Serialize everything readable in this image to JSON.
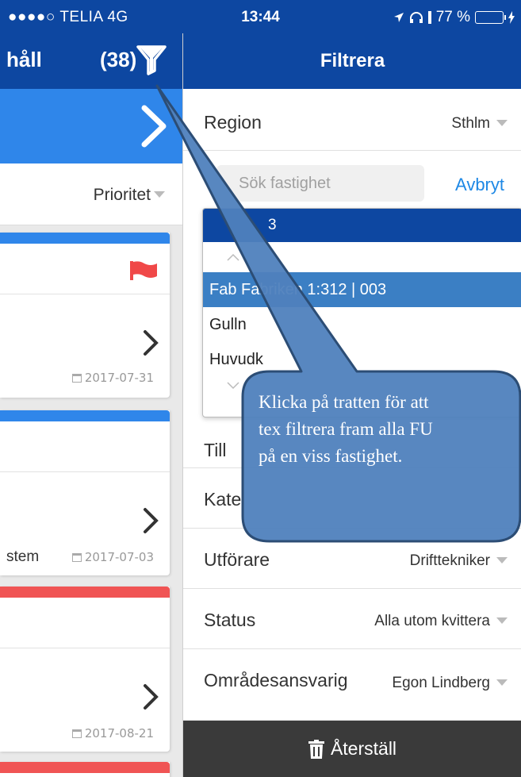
{
  "status_bar": {
    "carrier": "●●●●○ TELIA  4G",
    "time": "13:44",
    "battery": "77 %",
    "battery_level": 0.77
  },
  "left_pane": {
    "header_title": "håll",
    "count": "(38)",
    "sort_label": "Prioritet",
    "cards": [
      {
        "stripe_color": "#2f86ea",
        "flag": true,
        "note": "",
        "date": "2017-07-31"
      },
      {
        "stripe_color": "#2f86ea",
        "flag": false,
        "note": "stem",
        "date": "2017-07-03"
      },
      {
        "stripe_color": "#f05454",
        "flag": false,
        "note": "",
        "date": "2017-08-21"
      }
    ]
  },
  "filter_panel": {
    "title": "Filtrera",
    "region_label": "Region",
    "region_value": "Sthlm",
    "search_placeholder": "Sök fastighet",
    "cancel_label": "Avbryt",
    "dropdown": {
      "header": "3",
      "items": [
        {
          "label": "Fab     Fabriken 1:312 | 003",
          "selected": true
        },
        {
          "label": "Gulln",
          "selected": false
        },
        {
          "label": "Huvudk",
          "selected": false
        }
      ]
    },
    "rows": [
      {
        "label": "Till",
        "value": ""
      },
      {
        "label": "Kate",
        "value": ""
      },
      {
        "label": "Utförare",
        "value": "Drifttekniker"
      },
      {
        "label": "Status",
        "value": "Alla utom kvittera"
      },
      {
        "label": "Områdesansvarig",
        "value": "Egon Lindberg"
      }
    ],
    "reset_label": "Återställ"
  },
  "callout": {
    "text_line1": "Klicka på tratten för att",
    "text_line2": "tex filtrera fram alla FU",
    "text_line3": "på en viss fastighet."
  },
  "colors": {
    "header_blue": "#0d47a1",
    "accent_blue": "#2f86ea",
    "callout_fill": "#4f81bd",
    "callout_border": "#2c4d75",
    "flag_red": "#f04848"
  }
}
